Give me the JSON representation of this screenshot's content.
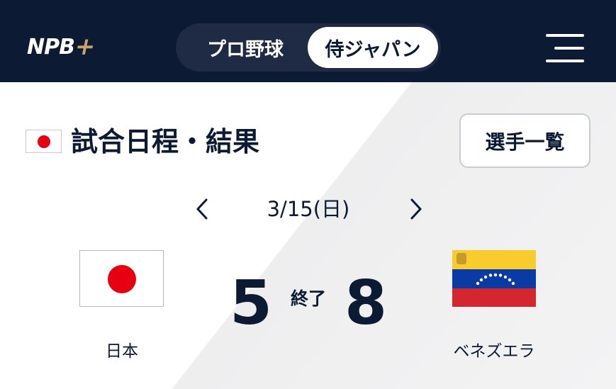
{
  "header": {
    "logo_main": "NPB",
    "logo_plus": "+",
    "tabs": [
      {
        "label": "プロ野球",
        "active": false
      },
      {
        "label": "侍ジャパン",
        "active": true
      }
    ],
    "menu_icon": "hamburger-menu-icon"
  },
  "colors": {
    "header_bg": "#0c1a33",
    "text_dark": "#0c1a33",
    "accent_gold": "#c7a46b",
    "japan_red": "#e60012"
  },
  "schedule": {
    "title": "試合日程・結果",
    "roster_button": "選手一覧",
    "date": "3/15(日)"
  },
  "game": {
    "home": {
      "name": "日本",
      "score": "5",
      "flag_icon": "japan-flag-icon"
    },
    "away": {
      "name": "ベネズエラ",
      "score": "8",
      "flag_icon": "venezuela-flag-icon"
    },
    "status": "終了"
  }
}
